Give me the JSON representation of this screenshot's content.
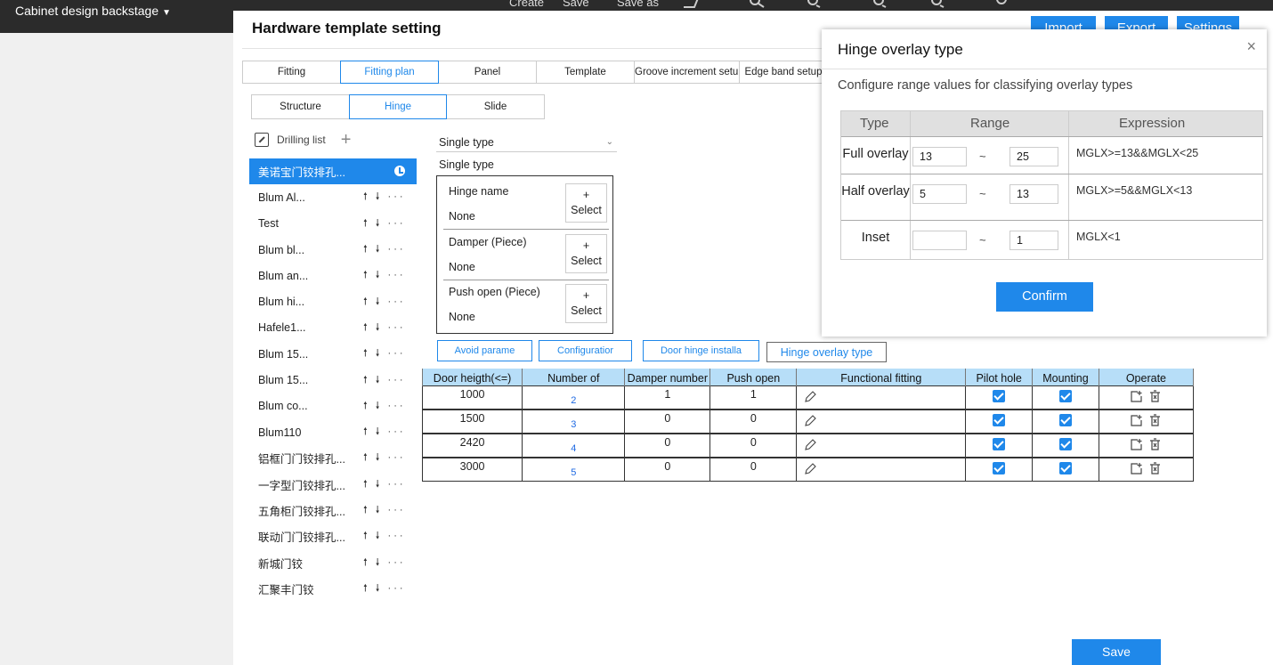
{
  "app": {
    "title": "Cabinet design backstage",
    "caret": "▼"
  },
  "topmenu": [
    "Create",
    "Save",
    "Save as"
  ],
  "colors": {
    "accent": "#1f88ea",
    "topbar": "#2b2b2b",
    "grid_header": "#b7def8"
  },
  "header": {
    "title": "Hardware template setting",
    "import": "Import",
    "export": "Export",
    "settings": "Settings"
  },
  "tabs_main": [
    "Fitting",
    "Fitting plan",
    "Panel",
    "Template",
    "Groove increment setup",
    "Edge band setup"
  ],
  "tabs_sub": [
    "Structure",
    "Hinge",
    "Slide"
  ],
  "sidebar": {
    "header": "Drilling list",
    "items": [
      "美诺宝门铰排孔...",
      "Blum Al...",
      "Test",
      "Blum bl...",
      "Blum an...",
      "Blum hi...",
      "Hafele1...",
      "Blum 15...",
      "Blum 15...",
      "Blum co...",
      "Blum110",
      "铝框门门铰排孔...",
      "一字型门铰排孔...",
      "五角柜门铰排孔...",
      "联动门门铰排孔...",
      "新城门铰",
      "汇聚丰门铰"
    ],
    "actions": "🠕 🠗 ···"
  },
  "hinge": {
    "type_select": "Single type",
    "single_label": "Single type",
    "rows": [
      {
        "label": "Hinge name",
        "value": "None",
        "btn_plus": "+",
        "btn": "Select"
      },
      {
        "label": "Damper  (Piece)",
        "value": "None",
        "btn_plus": "+",
        "btn": "Select"
      },
      {
        "label": "Push open  (Piece)",
        "value": "None",
        "btn_plus": "+",
        "btn": "Select"
      }
    ]
  },
  "buttons": {
    "avoid": "Avoid parame",
    "config": "Configuratior",
    "door_hinge": "Door hinge installa",
    "overlay": "Hinge overlay type",
    "save": "Save"
  },
  "grid": {
    "headers": [
      "Door heigth(<=)",
      "Number of",
      "Damper number",
      "Push open",
      "Functional fitting",
      "Pilot hole",
      "Mounting",
      "Operate"
    ],
    "rows": [
      {
        "height": "1000",
        "number": "2",
        "damper": "1",
        "push": "1"
      },
      {
        "height": "1500",
        "number": "3",
        "damper": "0",
        "push": "0"
      },
      {
        "height": "2420",
        "number": "4",
        "damper": "0",
        "push": "0"
      },
      {
        "height": "3000",
        "number": "5",
        "damper": "0",
        "push": "0"
      }
    ]
  },
  "dialog": {
    "title": "Hinge overlay type",
    "close": "×",
    "desc": "Configure range values for classifying overlay types",
    "headers": {
      "type": "Type",
      "range": "Range",
      "expr": "Expression"
    },
    "rows": [
      {
        "type": "Full overlay",
        "min": "13",
        "max": "25",
        "expr": "MGLX>=13&&MGLX<25"
      },
      {
        "type": "Half overlay",
        "min": "5",
        "max": "13",
        "expr": "MGLX>=5&&MGLX<13"
      },
      {
        "type": "Inset",
        "min": "",
        "max": "1",
        "expr": "MGLX<1"
      }
    ],
    "tilde": "~",
    "confirm": "Confirm"
  }
}
